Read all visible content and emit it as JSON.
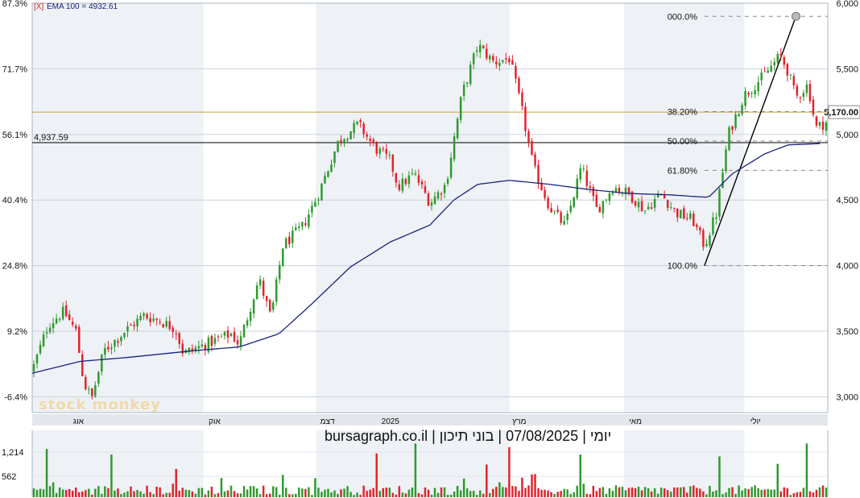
{
  "header": {
    "indicator_flag": "[X]",
    "indicator_text": "EMA 100 = 4932.61"
  },
  "caption": "יומי | 07/08/2025 | בוני תיכון | bursagraph.co.il",
  "watermark": "stock monkey",
  "colors": {
    "up": "#2e9a2e",
    "down": "#e0242a",
    "ema": "#1a237e",
    "resistance": "#c8a040",
    "support": "#000000",
    "shade": "#eef1f5"
  },
  "chart_data": {
    "type": "candlestick",
    "left_axis_ticks": [
      "87.3%",
      "71.7%",
      "56.1%",
      "40.4%",
      "24.8%",
      "9.2%",
      "-6.4%"
    ],
    "right_axis_ticks": [
      {
        "value": 6000,
        "label": "6,000"
      },
      {
        "value": 5500,
        "label": "5,500"
      },
      {
        "value": 5000,
        "label": "5,000"
      },
      {
        "value": 4500,
        "label": "4,500"
      },
      {
        "value": 4000,
        "label": "4,000"
      },
      {
        "value": 3500,
        "label": "3,500"
      },
      {
        "value": 3000,
        "label": "3,000"
      }
    ],
    "ylim": [
      2880,
      6000
    ],
    "months": [
      {
        "label": "אוג",
        "pos": 0.044
      },
      {
        "label": "אוק",
        "pos": 0.215
      },
      {
        "label": "דצמ",
        "pos": 0.357
      },
      {
        "label": "2025",
        "pos": 0.436
      },
      {
        "label": "מרץ",
        "pos": 0.598
      },
      {
        "label": "מאי",
        "pos": 0.744
      },
      {
        "label": "יולי",
        "pos": 0.895
      }
    ],
    "shaded_bands": [
      [
        0.0,
        0.215
      ],
      [
        0.357,
        0.6
      ],
      [
        0.744,
        0.895
      ]
    ],
    "price_path": [
      [
        0.0,
        3200
      ],
      [
        0.02,
        3550
      ],
      [
        0.04,
        3650
      ],
      [
        0.055,
        3500
      ],
      [
        0.065,
        3100
      ],
      [
        0.075,
        2990
      ],
      [
        0.09,
        3350
      ],
      [
        0.12,
        3520
      ],
      [
        0.14,
        3620
      ],
      [
        0.16,
        3580
      ],
      [
        0.18,
        3520
      ],
      [
        0.19,
        3330
      ],
      [
        0.21,
        3380
      ],
      [
        0.25,
        3480
      ],
      [
        0.26,
        3400
      ],
      [
        0.285,
        3900
      ],
      [
        0.3,
        3600
      ],
      [
        0.315,
        4150
      ],
      [
        0.34,
        4300
      ],
      [
        0.36,
        4550
      ],
      [
        0.385,
        4950
      ],
      [
        0.41,
        5080
      ],
      [
        0.43,
        4900
      ],
      [
        0.45,
        4800
      ],
      [
        0.46,
        4600
      ],
      [
        0.48,
        4700
      ],
      [
        0.5,
        4480
      ],
      [
        0.52,
        4620
      ],
      [
        0.54,
        5300
      ],
      [
        0.56,
        5680
      ],
      [
        0.58,
        5550
      ],
      [
        0.6,
        5580
      ],
      [
        0.615,
        5200
      ],
      [
        0.63,
        4750
      ],
      [
        0.65,
        4450
      ],
      [
        0.67,
        4300
      ],
      [
        0.69,
        4750
      ],
      [
        0.71,
        4420
      ],
      [
        0.73,
        4600
      ],
      [
        0.75,
        4550
      ],
      [
        0.77,
        4420
      ],
      [
        0.79,
        4550
      ],
      [
        0.81,
        4400
      ],
      [
        0.83,
        4350
      ],
      [
        0.845,
        4150
      ],
      [
        0.86,
        4400
      ],
      [
        0.875,
        5000
      ],
      [
        0.895,
        5300
      ],
      [
        0.92,
        5450
      ],
      [
        0.94,
        5600
      ],
      [
        0.95,
        5480
      ],
      [
        0.96,
        5280
      ],
      [
        0.975,
        5380
      ],
      [
        0.985,
        5050
      ],
      [
        1.0,
        5100
      ]
    ],
    "ema_path": [
      [
        0.0,
        3180
      ],
      [
        0.06,
        3270
      ],
      [
        0.12,
        3300
      ],
      [
        0.2,
        3350
      ],
      [
        0.26,
        3380
      ],
      [
        0.31,
        3480
      ],
      [
        0.35,
        3700
      ],
      [
        0.4,
        3990
      ],
      [
        0.45,
        4180
      ],
      [
        0.5,
        4310
      ],
      [
        0.53,
        4500
      ],
      [
        0.56,
        4620
      ],
      [
        0.6,
        4650
      ],
      [
        0.65,
        4620
      ],
      [
        0.7,
        4580
      ],
      [
        0.75,
        4550
      ],
      [
        0.8,
        4540
      ],
      [
        0.85,
        4520
      ],
      [
        0.88,
        4700
      ],
      [
        0.92,
        4850
      ],
      [
        0.95,
        4920
      ],
      [
        0.99,
        4930
      ]
    ],
    "horizontal_lines": [
      {
        "label": "4,937.59",
        "value": 4937.59,
        "style": "support"
      },
      {
        "value": 5170,
        "style": "resistance"
      }
    ],
    "last_price_label": "5,170.00",
    "fibonacci": {
      "from": {
        "pos": 0.845,
        "value": 4000
      },
      "to": {
        "pos": 0.96,
        "value": 5900
      },
      "levels": [
        {
          "label": "000.0%",
          "value": 5900
        },
        {
          "label": "38.20%",
          "value": 5174
        },
        {
          "label": "50.00%",
          "value": 4950
        },
        {
          "label": "61.80%",
          "value": 4726
        },
        {
          "label": "100.0%",
          "value": 4000
        }
      ]
    },
    "volume_ticks": [
      {
        "value": 1214,
        "label": "1,214"
      },
      {
        "value": 562,
        "label": "562"
      }
    ],
    "volume_max": 1500
  }
}
